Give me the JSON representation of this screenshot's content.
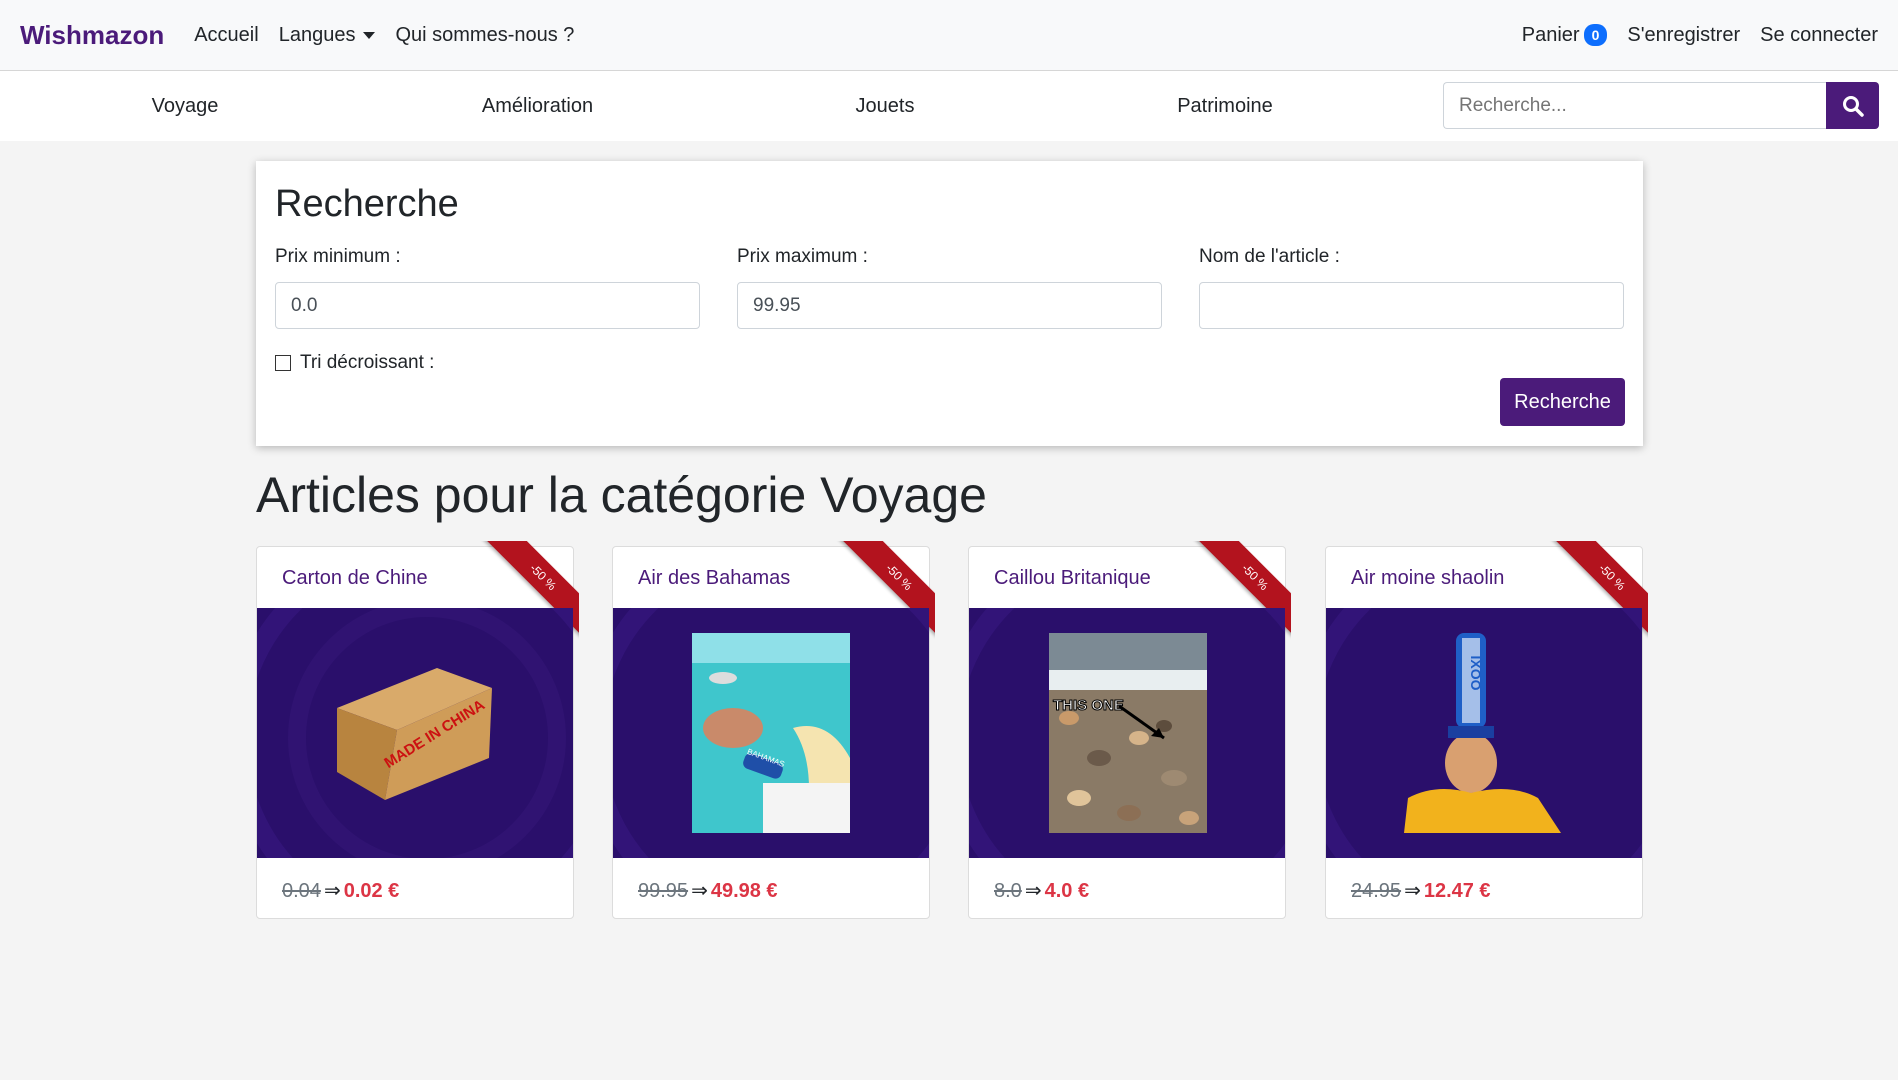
{
  "navbar": {
    "brand": "Wishmazon",
    "links": [
      "Accueil",
      "Langues",
      "Qui sommes-nous ?"
    ],
    "cart_label": "Panier",
    "cart_count": "0",
    "register": "S'enregistrer",
    "login": "Se connecter"
  },
  "categories": [
    "Voyage",
    "Amélioration",
    "Jouets",
    "Patrimoine"
  ],
  "search": {
    "placeholder": "Recherche..."
  },
  "filter": {
    "title": "Recherche",
    "min_label": "Prix minimum :",
    "min_value": "0.0",
    "max_label": "Prix maximum :",
    "max_value": "99.95",
    "name_label": "Nom de l'article :",
    "name_value": "",
    "sort_label": "Tri décroissant :",
    "button": "Recherche"
  },
  "section_title": "Articles pour la catégorie Voyage",
  "products": [
    {
      "name": "Carton de Chine",
      "old_price": "0.04",
      "arrow": "⇒",
      "new_price": "0.02 €",
      "ribbon": "-50 %"
    },
    {
      "name": "Air des Bahamas",
      "old_price": "99.95",
      "arrow": "⇒",
      "new_price": "49.98 €",
      "ribbon": "-50 %"
    },
    {
      "name": "Caillou Britanique",
      "old_price": "8.0",
      "arrow": "⇒",
      "new_price": "4.0 €",
      "ribbon": "-50 %"
    },
    {
      "name": "Air moine shaolin",
      "old_price": "24.95",
      "arrow": "⇒",
      "new_price": "12.47 €",
      "ribbon": "-50 %"
    }
  ],
  "images": {
    "box_text": "MADE IN CHINA",
    "bottle_text": "BAHAMAS",
    "rock_text": "THIS ONE",
    "can_text": "IXOO"
  },
  "colors": {
    "brand": "#4b1b7a",
    "discount": "#dc3545",
    "ribbon": "#b3131e",
    "badge": "#0d6efd"
  }
}
